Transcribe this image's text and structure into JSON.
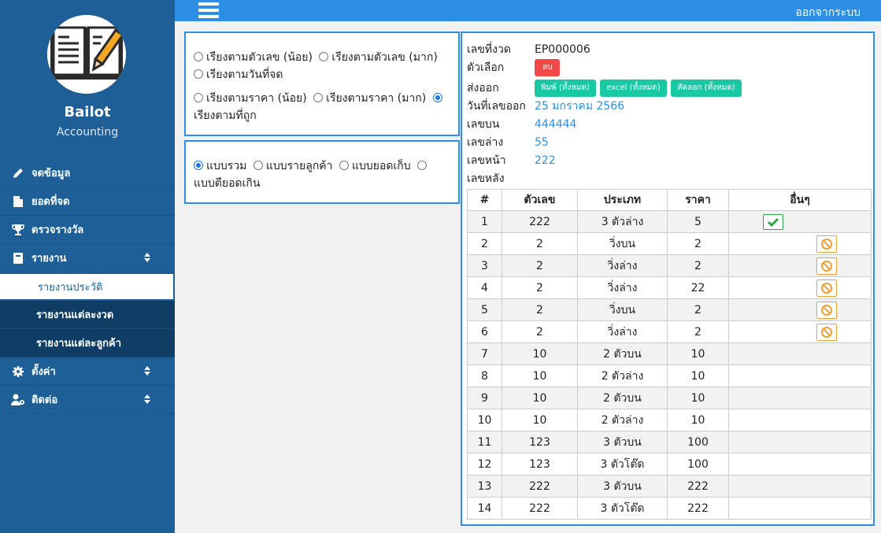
{
  "sidebar": {
    "brand": "Bailot",
    "subtitle": "Accounting",
    "items": [
      {
        "label": "จดข้อมูล",
        "icon": "pencil-icon"
      },
      {
        "label": "ยอดที่จด",
        "icon": "file-icon"
      },
      {
        "label": "ตรวจรางวัล",
        "icon": "trophy-icon"
      },
      {
        "label": "รายงาน",
        "icon": "book-icon"
      },
      {
        "label": "ตั้งค่า",
        "icon": "gear-icon"
      },
      {
        "label": "ติดต่อ",
        "icon": "user-cog-icon"
      }
    ],
    "submenu": [
      {
        "label": "รายงานประวัติ"
      },
      {
        "label": "รายงานแต่ละงวด"
      },
      {
        "label": "รายงานแต่ละลูกค้า"
      }
    ]
  },
  "header": {
    "logout": "ออกจากระบบ"
  },
  "sort_options": [
    "เรียงตามตัวเลข (น้อย)",
    "เรียงตามตัวเลข (มาก)",
    "เรียงตามวันที่จด",
    "เรียงตามราคา (น้อย)",
    "เรียงตามราคา (มาก)",
    "เรียงตามที่ถูก"
  ],
  "sort_selected": "เรียงตามที่ถูก",
  "view_options": [
    "แบบรวม",
    "แบบรายลูกค้า",
    "แบบยอดเก็บ",
    "แบบตียอดเกิน"
  ],
  "view_selected": "แบบรวม",
  "detail": {
    "period_label": "เลขที่งวด",
    "period_value": "EP000006",
    "options_label": "ตัวเลือก",
    "delete_btn": "ลบ",
    "export_label": "ส่งออก",
    "export_print": "พิมพ์ (ทั้งหมด)",
    "export_excel": "excel (ทั้งหมด)",
    "export_copy": "คัดลอก (ทั้งหมด)",
    "date_label": "วันที่เลขออก",
    "date_value": "25 มกราคม 2566",
    "top_label": "เลขบน",
    "top_value": "444444",
    "bottom_label": "เลขล่าง",
    "bottom_value": "55",
    "front_label": "เลขหน้า",
    "front_value": "222",
    "back_label": "เลขหลัง",
    "back_value": ""
  },
  "table": {
    "headers": [
      "#",
      "ตัวเลข",
      "ประเภท",
      "ราคา",
      "อื่นๆ"
    ],
    "rows": [
      {
        "n": "1",
        "num": "222",
        "type": "3 ตัวล่าง",
        "price": "5",
        "action": "check-icon"
      },
      {
        "n": "2",
        "num": "2",
        "type": "วิ่งบน",
        "price": "2",
        "action": "ban-icon"
      },
      {
        "n": "3",
        "num": "2",
        "type": "วิ่งล่าง",
        "price": "2",
        "action": "ban-icon"
      },
      {
        "n": "4",
        "num": "2",
        "type": "วิ่งล่าง",
        "price": "22",
        "action": "ban-icon"
      },
      {
        "n": "5",
        "num": "2",
        "type": "วิ่งบน",
        "price": "2",
        "action": "ban-icon"
      },
      {
        "n": "6",
        "num": "2",
        "type": "วิ่งล่าง",
        "price": "2",
        "action": "ban-icon"
      },
      {
        "n": "7",
        "num": "10",
        "type": "2 ตัวบน",
        "price": "10",
        "action": ""
      },
      {
        "n": "8",
        "num": "10",
        "type": "2 ตัวล่าง",
        "price": "10",
        "action": ""
      },
      {
        "n": "9",
        "num": "10",
        "type": "2 ตัวบน",
        "price": "10",
        "action": ""
      },
      {
        "n": "10",
        "num": "10",
        "type": "2 ตัวล่าง",
        "price": "10",
        "action": ""
      },
      {
        "n": "11",
        "num": "123",
        "type": "3 ตัวบน",
        "price": "100",
        "action": ""
      },
      {
        "n": "12",
        "num": "123",
        "type": "3 ตัวโต๊ด",
        "price": "100",
        "action": ""
      },
      {
        "n": "13",
        "num": "222",
        "type": "3 ตัวบน",
        "price": "222",
        "action": ""
      },
      {
        "n": "14",
        "num": "222",
        "type": "3 ตัวโต๊ด",
        "price": "222",
        "action": ""
      }
    ]
  },
  "colors": {
    "sidebar": "#1d5f96",
    "topbar": "#2c8ee4",
    "danger": "#f14848",
    "teal": "#18c9a4",
    "ok": "#28a745",
    "warn": "#f0a030"
  }
}
